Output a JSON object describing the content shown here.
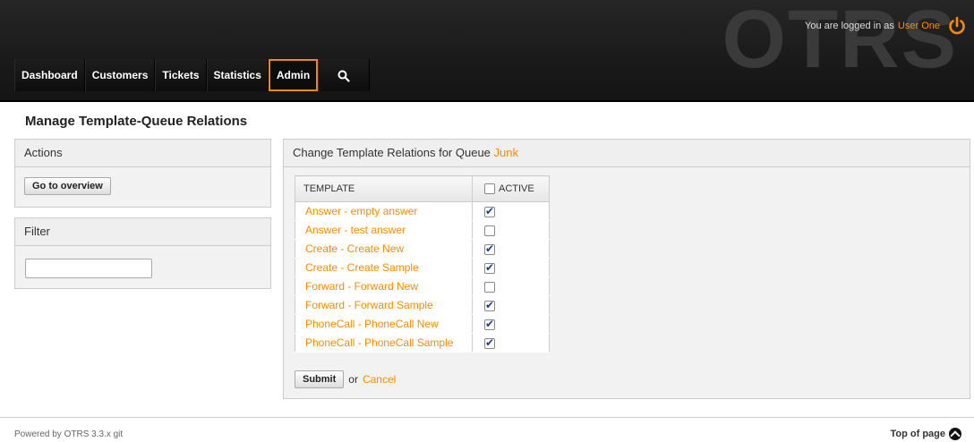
{
  "header": {
    "logo_text": "OTRS",
    "login_prefix": "You are logged in as",
    "user_name": "User One"
  },
  "nav": {
    "items": [
      {
        "label": "Dashboard"
      },
      {
        "label": "Customers"
      },
      {
        "label": "Tickets"
      },
      {
        "label": "Statistics"
      },
      {
        "label": "Admin",
        "active": true
      }
    ],
    "search_icon": "search-icon"
  },
  "page": {
    "title": "Manage Template-Queue Relations"
  },
  "sidebar": {
    "actions_title": "Actions",
    "go_to_overview": "Go to overview",
    "filter_title": "Filter",
    "filter_value": ""
  },
  "main": {
    "header_prefix": "Change Template Relations for Queue",
    "queue_name": "Junk",
    "columns": {
      "template": "TEMPLATE",
      "active": "ACTIVE"
    },
    "rows": [
      {
        "template": "Answer - empty answer",
        "active": true
      },
      {
        "template": "Answer - test answer",
        "active": false
      },
      {
        "template": "Create - Create New",
        "active": true
      },
      {
        "template": "Create - Create Sample",
        "active": true
      },
      {
        "template": "Forward - Forward New",
        "active": false
      },
      {
        "template": "Forward - Forward Sample",
        "active": true
      },
      {
        "template": "PhoneCall - PhoneCall New",
        "active": true
      },
      {
        "template": "PhoneCall - PhoneCall Sample",
        "active": true
      }
    ],
    "submit_label": "Submit",
    "or_text": "or",
    "cancel_label": "Cancel"
  },
  "footer": {
    "powered_by": "Powered by OTRS 3.3.x git",
    "top_of_page": "Top of page"
  },
  "colors": {
    "accent": "#ff8a00",
    "header_bg": "#1a1a1a"
  }
}
